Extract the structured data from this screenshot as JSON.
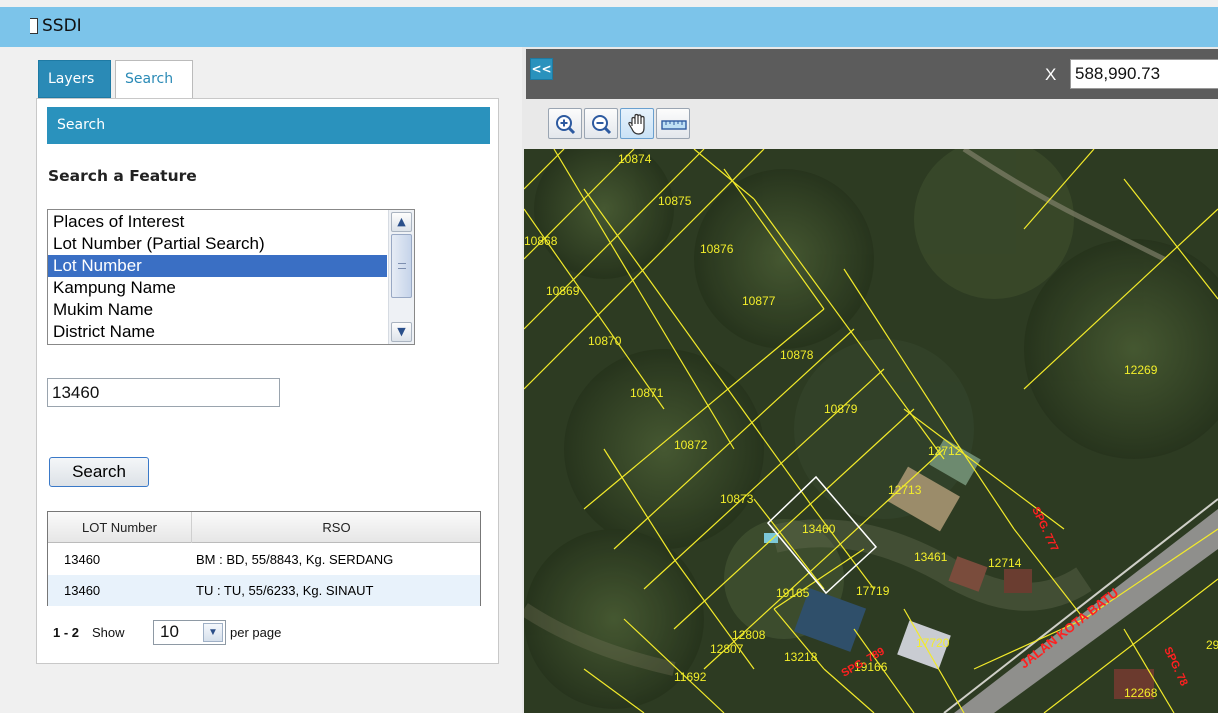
{
  "window": {
    "title": "SSDI"
  },
  "tabs": [
    {
      "label": "Layers",
      "active": false
    },
    {
      "label": "Search",
      "active": true
    }
  ],
  "panel": {
    "header": "Search",
    "section_title": "Search a Feature",
    "feature_list": {
      "items": [
        "Places of Interest",
        "Lot Number (Partial Search)",
        "Lot Number",
        "Kampung Name",
        "Mukim Name",
        "District Name"
      ],
      "selected_index": 2
    },
    "search_value": "13460",
    "search_button": "Search",
    "results": {
      "columns": [
        "LOT Number",
        "RSO"
      ],
      "rows": [
        [
          "13460",
          "BM : BD, 55/8843, Kg. SERDANG"
        ],
        [
          "13460",
          "TU : TU, 55/6233, Kg. SINAUT"
        ]
      ]
    },
    "pager": {
      "range": "1 - 2",
      "show_label": "Show",
      "per_page_value": "10",
      "per_page_label": "per page"
    }
  },
  "map": {
    "collapse_label": "<<",
    "coord_label": "X",
    "coord_value": "588,990.73",
    "tools": [
      "zoom-in-icon",
      "zoom-out-icon",
      "pan-hand-icon",
      "measure-ruler-icon"
    ],
    "active_tool": "pan-hand-icon",
    "colors": {
      "parcel_line": "#f2ea2a",
      "parcel_label": "#f3ee2a",
      "road_label": "#ff2020",
      "highlight": "#ffffff"
    },
    "lot_labels": [
      "10874",
      "10875",
      "10868",
      "10876",
      "10869",
      "10877",
      "10870",
      "10878",
      "12269",
      "10871",
      "10879",
      "10872",
      "12712",
      "12713",
      "10873",
      "13460",
      "13461",
      "12714",
      "19165",
      "17719",
      "12808",
      "12807",
      "13218",
      "17720",
      "19166",
      "11692",
      "12268",
      "29"
    ],
    "road_labels": [
      "JALAN KOTA BATU",
      "SPG. 789",
      "SPG. 777",
      "SPG. 78"
    ]
  }
}
